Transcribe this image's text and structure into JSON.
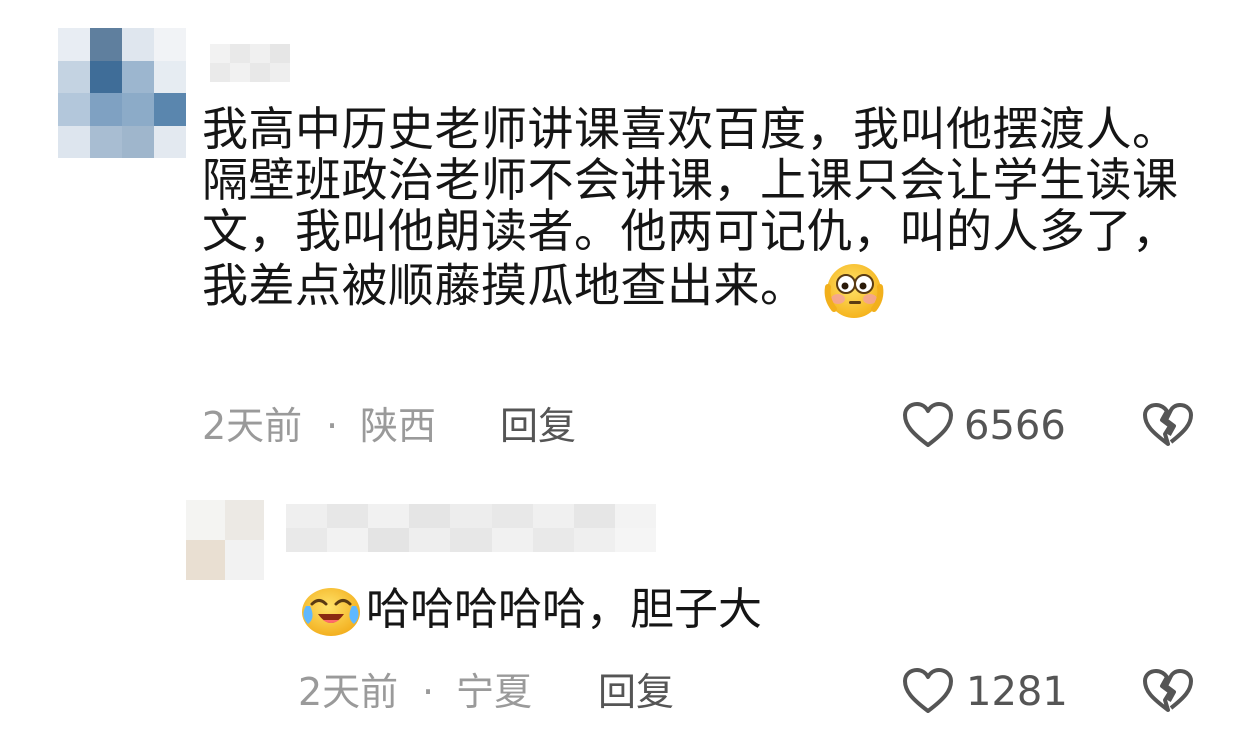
{
  "comment": {
    "text": "我高中历史老师讲课喜欢百度，我叫他摆渡人。隔壁班政治老师不会讲课，上课只会让学生读课文，我叫他朗读者。他两可记仇，叫的人多了，我差点被顺藤摸瓜地查出来。",
    "emoji_icon": "flushed-face-icon",
    "time": "2天前",
    "separator": "·",
    "location": "陕西",
    "reply_label": "回复",
    "likes": "6566"
  },
  "reply": {
    "emoji_icon": "crying-laughing-face-icon",
    "text": "哈哈哈哈哈，胆子大",
    "time": "2天前",
    "separator": "·",
    "location": "宁夏",
    "reply_label": "回复",
    "likes": "1281"
  },
  "colors": {
    "text": "#151515",
    "meta": "#9a9a9a",
    "icon": "#555555"
  }
}
